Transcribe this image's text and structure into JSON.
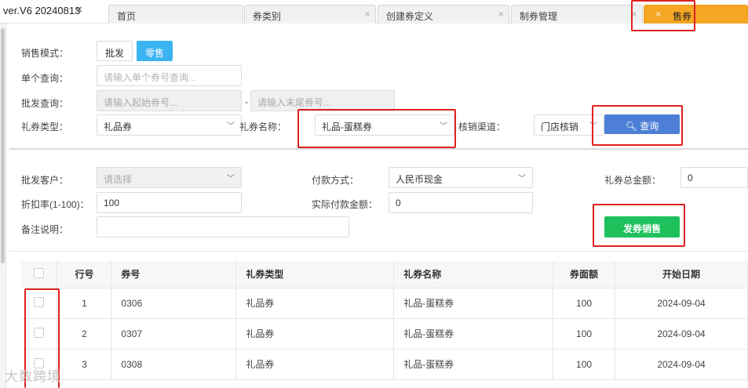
{
  "header": {
    "version": "ver.V6 20240813",
    "collapse_icon": "«",
    "tabs": [
      {
        "label": "首页"
      },
      {
        "label": "券类别"
      },
      {
        "label": "创建券定义"
      },
      {
        "label": "制券管理"
      },
      {
        "label": "售券"
      }
    ],
    "active_tab_color": "#f5a623"
  },
  "form": {
    "mode_label": "销售模式：",
    "mode_wholesale": "批发",
    "mode_retail": "零售",
    "single_query_label": "单个查询：",
    "single_query_placeholder": "请输入单个券号查询...",
    "batch_query_label": "批发查询：",
    "batch_start_placeholder": "请输入起始券号...",
    "batch_dash": "-",
    "batch_end_placeholder": "请输入末尾券号...",
    "voucher_type_label": "礼券类型：",
    "voucher_type_value": "礼品券",
    "voucher_name_label": "礼券名称：",
    "voucher_name_value": "礼品-蛋糕券",
    "channel_label": "核销渠道：",
    "channel_value": "门店核销",
    "query_button": "查询",
    "query_color": "#4e7fd6"
  },
  "sale": {
    "customer_label": "批发客户：",
    "customer_placeholder": "请选择",
    "payment_label": "付款方式：",
    "payment_value": "人民币现金",
    "total_label": "礼券总金额：",
    "total_value": "0",
    "discount_label": "折扣率(1-100)：",
    "discount_value": "100",
    "actual_label": "实际付款金额：",
    "actual_value": "0",
    "remark_label": "备注说明：",
    "remark_value": "",
    "issue_button": "发券销售",
    "issue_color": "#1ec15c"
  },
  "table": {
    "headers": [
      "行号",
      "券号",
      "礼券类型",
      "礼券名称",
      "券面额",
      "开始日期"
    ],
    "rows": [
      {
        "row": "1",
        "code": "0306",
        "type": "礼品券",
        "name": "礼品-蛋糕券",
        "amount": "100",
        "start": "2024-09-04"
      },
      {
        "row": "2",
        "code": "0307",
        "type": "礼品券",
        "name": "礼品-蛋糕券",
        "amount": "100",
        "start": "2024-09-04"
      },
      {
        "row": "3",
        "code": "0308",
        "type": "礼品券",
        "name": "礼品-蛋糕券",
        "amount": "100",
        "start": "2024-09-04"
      }
    ]
  },
  "watermark": "大数跨境"
}
